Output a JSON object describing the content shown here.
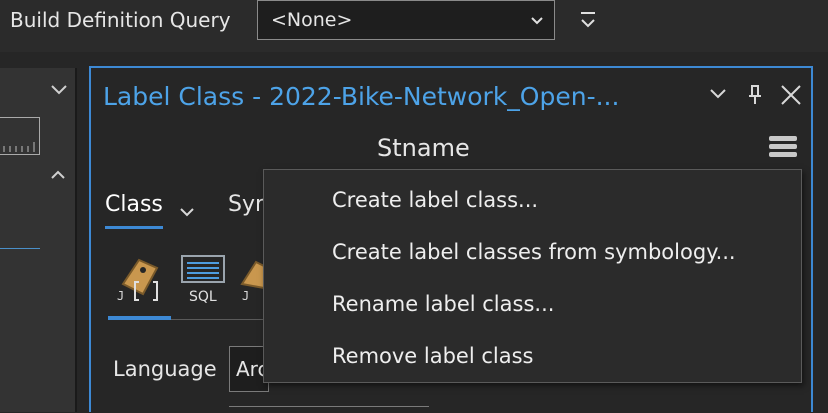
{
  "toolbar": {
    "build_definition_query_label": "Build Definition Query",
    "query_select_value": "<None>",
    "extra_icon": "filter-dropdown-icon"
  },
  "left_pane": {
    "collapse_icon": "chevron-down-icon",
    "scroll_icon": "chevron-up-icon"
  },
  "panel": {
    "title": "Label Class - 2022-Bike-Network_Open-...",
    "tools": [
      "chevron-down-icon",
      "pin-icon",
      "close-icon"
    ],
    "subtitle": "Stname",
    "menu_icon": "hamburger-icon",
    "accent_color": "#3d89d4"
  },
  "tabs": {
    "class_label": "Class",
    "symbol_label": "Sym"
  },
  "sub_icons": [
    "label-expression-icon",
    "sql-query-icon",
    "label-placement-icon"
  ],
  "sql_icon_text": "SQL",
  "language": {
    "label": "Language",
    "value": "Arcade"
  },
  "context_menu": {
    "items": [
      "Create label class...",
      "Create label classes from symbology...",
      "Rename label class...",
      "Remove label class"
    ]
  }
}
